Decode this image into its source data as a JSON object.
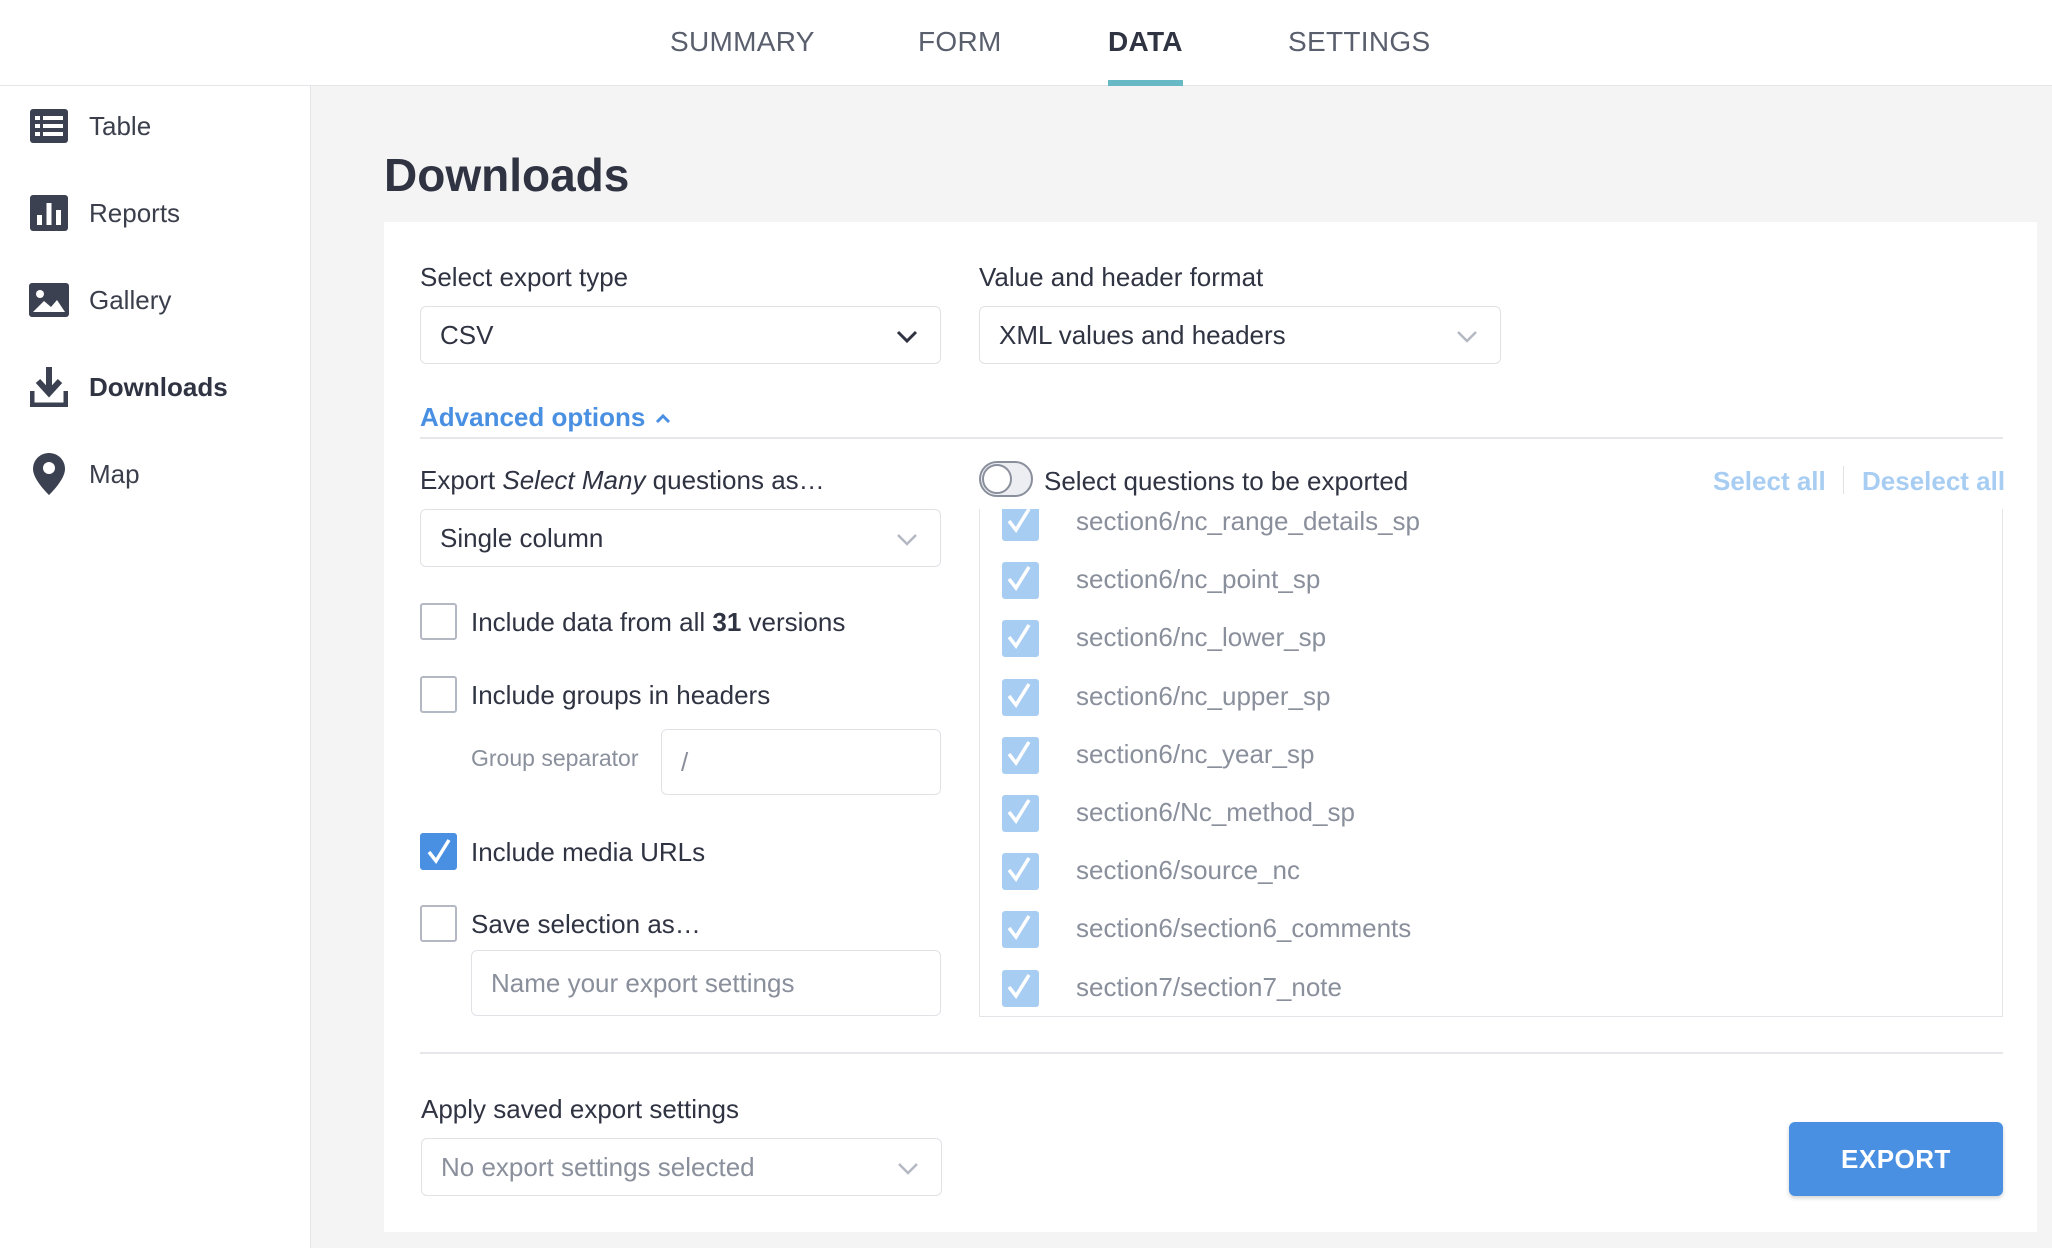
{
  "tabs": [
    "SUMMARY",
    "FORM",
    "DATA",
    "SETTINGS"
  ],
  "active_tab": "DATA",
  "sidebar": {
    "items": [
      {
        "label": "Table",
        "icon": "table-icon"
      },
      {
        "label": "Reports",
        "icon": "bar-chart-icon"
      },
      {
        "label": "Gallery",
        "icon": "image-icon"
      },
      {
        "label": "Downloads",
        "icon": "download-icon",
        "active": true
      },
      {
        "label": "Map",
        "icon": "map-pin-icon"
      }
    ]
  },
  "page": {
    "title": "Downloads"
  },
  "export_type": {
    "label": "Select export type",
    "value": "CSV"
  },
  "header_format": {
    "label": "Value and header format",
    "value": "XML values and headers"
  },
  "advanced": {
    "label": "Advanced options"
  },
  "select_many": {
    "label_prefix": "Export ",
    "label_em": "Select Many",
    "label_suffix": " questions as…",
    "value": "Single column"
  },
  "options": {
    "all_versions": {
      "prefix": "Include data from all ",
      "count": "31",
      "suffix": " versions",
      "checked": false
    },
    "groups_in_headers": {
      "label": "Include groups in headers",
      "checked": false
    },
    "group_separator": {
      "label": "Group separator",
      "value": "/"
    },
    "media_urls": {
      "label": "Include media URLs",
      "checked": true
    },
    "save_selection": {
      "label": "Save selection as…",
      "checked": false,
      "placeholder": "Name your export settings"
    }
  },
  "questions": {
    "toggle_label": "Select questions to be exported",
    "toggle_on": false,
    "select_all": "Select all",
    "deselect_all": "Deselect all",
    "items": [
      "section6/nc_range_details_sp",
      "section6/nc_point_sp",
      "section6/nc_lower_sp",
      "section6/nc_upper_sp",
      "section6/nc_year_sp",
      "section6/Nc_method_sp",
      "section6/source_nc",
      "section6/section6_comments",
      "section7/section7_note"
    ]
  },
  "saved_settings": {
    "label": "Apply saved export settings",
    "value": "No export settings selected"
  },
  "export_button": "EXPORT",
  "colors": {
    "accent": "#4a90e2",
    "tab_underline": "#67b9c6",
    "disabled_check": "#a8cdf2"
  }
}
